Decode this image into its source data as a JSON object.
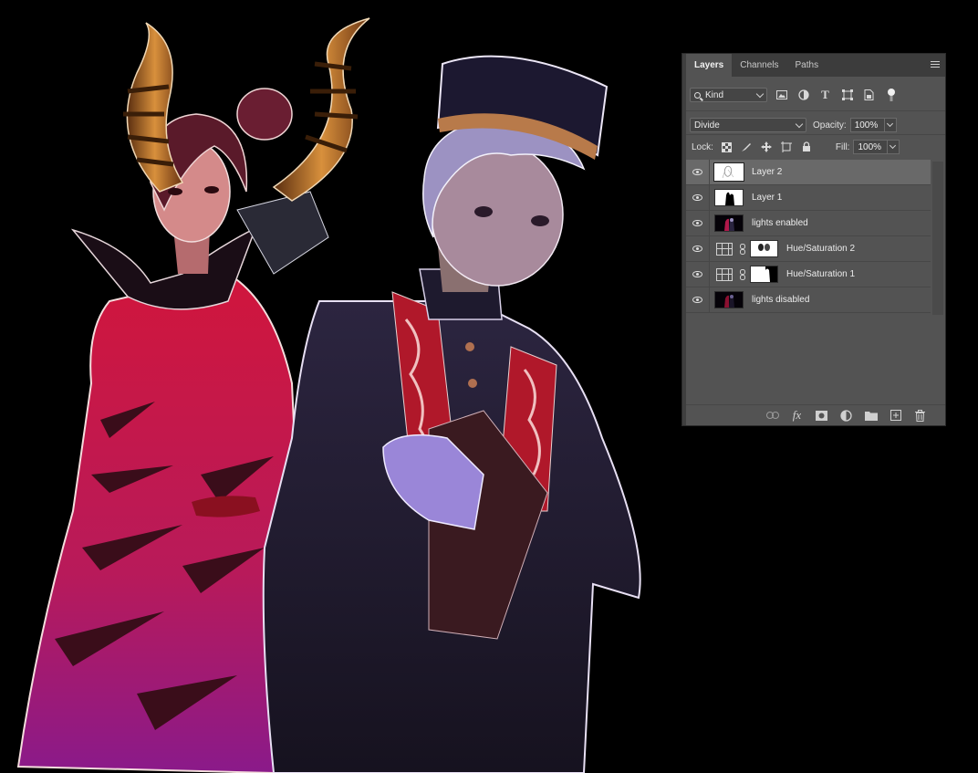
{
  "panel": {
    "tabs": [
      {
        "label": "Layers",
        "active": true
      },
      {
        "label": "Channels",
        "active": false
      },
      {
        "label": "Paths",
        "active": false
      }
    ],
    "menu_icon": "hamburger-menu-icon",
    "filter": {
      "kind_label": "Kind",
      "icons": [
        "image-filter-icon",
        "adjustment-filter-icon",
        "type-filter-icon",
        "shape-filter-icon",
        "smart-object-filter-icon",
        "filter-toggle-icon"
      ]
    },
    "blend": {
      "mode": "Divide",
      "opacity_label": "Opacity:",
      "opacity_value": "100%"
    },
    "lock": {
      "label": "Lock:",
      "icons": [
        "lock-transparent-icon",
        "lock-pixels-icon",
        "lock-position-icon",
        "lock-artboard-icon",
        "lock-all-icon"
      ],
      "fill_label": "Fill:",
      "fill_value": "100%"
    },
    "layers": [
      {
        "name": "Layer 2",
        "type": "pixel",
        "selected": true,
        "visible": true,
        "thumb": "sketch"
      },
      {
        "name": "Layer 1",
        "type": "pixel",
        "selected": false,
        "visible": true,
        "thumb": "silhouette"
      },
      {
        "name": "lights enabled",
        "type": "pixel",
        "selected": false,
        "visible": true,
        "thumb": "render-lit"
      },
      {
        "name": "Hue/Saturation 2",
        "type": "adjustment",
        "selected": false,
        "visible": true,
        "thumb": "mask-blobs"
      },
      {
        "name": "Hue/Saturation 1",
        "type": "adjustment",
        "selected": false,
        "visible": true,
        "thumb": "mask-figure"
      },
      {
        "name": "lights disabled",
        "type": "pixel",
        "selected": false,
        "visible": true,
        "thumb": "render-unlit"
      }
    ],
    "footer_icons": [
      "link-layers-icon",
      "fx-icon",
      "add-mask-icon",
      "new-adjustment-icon",
      "new-group-icon",
      "new-layer-icon",
      "trash-icon"
    ]
  },
  "colors": {
    "canvas_bg": "#000000",
    "panel_bg": "#535353",
    "selected_row": "#696969",
    "tab_bar": "#3c3c3c"
  }
}
